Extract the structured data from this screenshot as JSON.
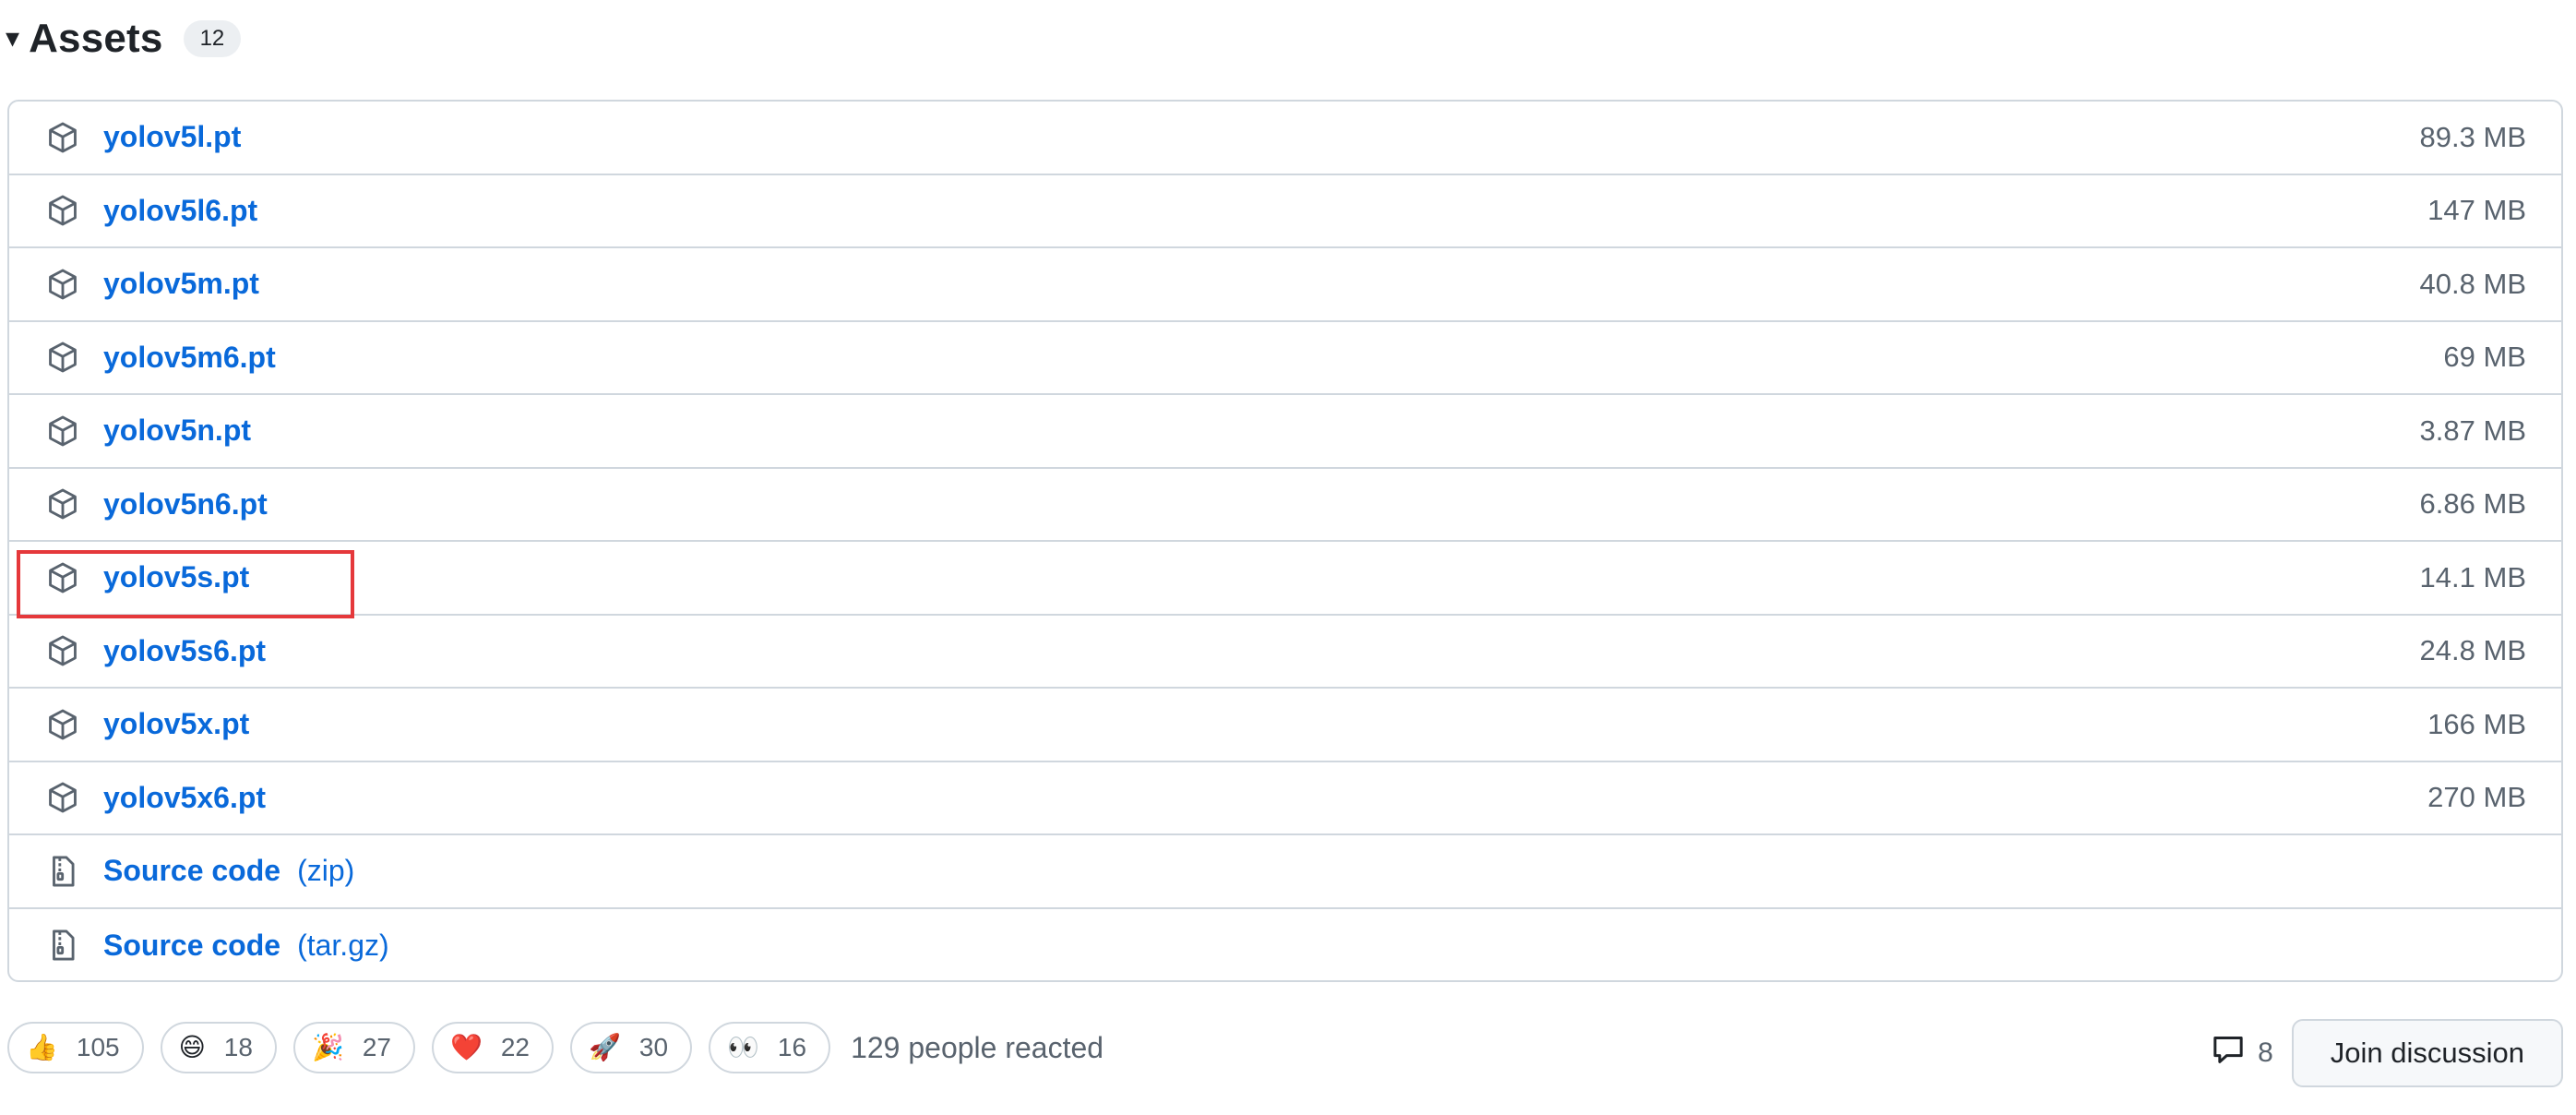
{
  "assets": {
    "caret": "▾",
    "title": "Assets",
    "count": "12",
    "items": [
      {
        "name": "yolov5l.pt",
        "size": "89.3 MB"
      },
      {
        "name": "yolov5l6.pt",
        "size": "147 MB"
      },
      {
        "name": "yolov5m.pt",
        "size": "40.8 MB"
      },
      {
        "name": "yolov5m6.pt",
        "size": "69 MB"
      },
      {
        "name": "yolov5n.pt",
        "size": "3.87 MB"
      },
      {
        "name": "yolov5n6.pt",
        "size": "6.86 MB"
      },
      {
        "name": "yolov5s.pt",
        "size": "14.1 MB"
      },
      {
        "name": "yolov5s6.pt",
        "size": "24.8 MB"
      },
      {
        "name": "yolov5x.pt",
        "size": "166 MB"
      },
      {
        "name": "yolov5x6.pt",
        "size": "270 MB"
      }
    ],
    "source_zip": {
      "label": "Source code",
      "ext": "(zip)"
    },
    "source_targz": {
      "label": "Source code",
      "ext": "(tar.gz)"
    }
  },
  "icons": {
    "package": "package-icon",
    "file_zip": "file-zip-icon",
    "comment": "comment-icon"
  },
  "reactions": [
    {
      "emoji": "👍",
      "name": "thumbs-up",
      "count": "105"
    },
    {
      "emoji": "😄",
      "name": "laugh",
      "count": "18"
    },
    {
      "emoji": "🎉",
      "name": "hooray",
      "count": "27"
    },
    {
      "emoji": "❤️",
      "name": "heart",
      "count": "22"
    },
    {
      "emoji": "🚀",
      "name": "rocket",
      "count": "30"
    },
    {
      "emoji": "👀",
      "name": "eyes",
      "count": "16"
    }
  ],
  "people_reacted": "129 people reacted",
  "discussion": {
    "comment_count": "8",
    "join_label": "Join discussion"
  },
  "colors": {
    "link": "#0969da",
    "border": "#d0d7de",
    "highlight": "#e5383b",
    "muted": "#59636e"
  }
}
